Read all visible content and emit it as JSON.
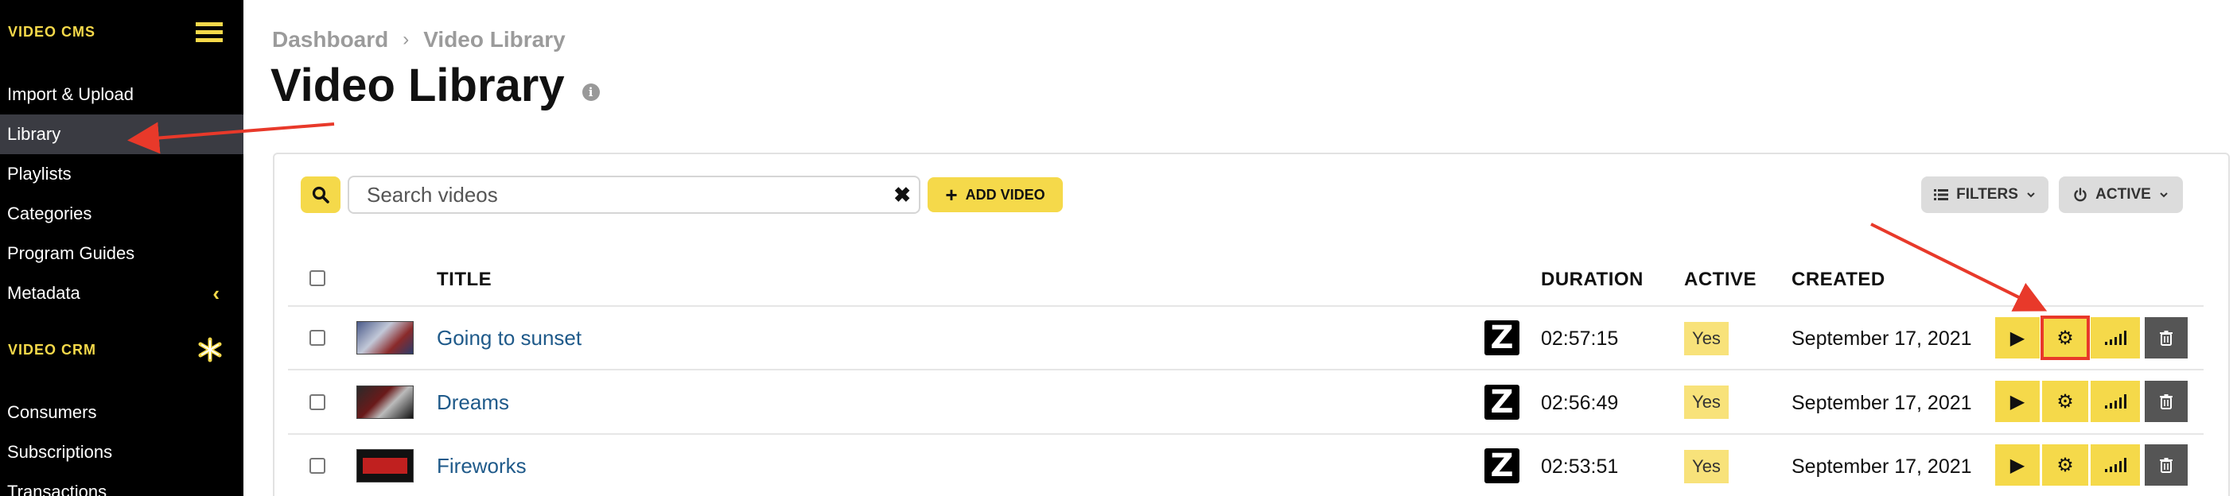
{
  "sidebar": {
    "sections": [
      {
        "title": "VIDEO CMS"
      },
      {
        "title": "VIDEO CRM"
      }
    ],
    "cms_items": [
      {
        "label": "Import & Upload"
      },
      {
        "label": "Library"
      },
      {
        "label": "Playlists"
      },
      {
        "label": "Categories"
      },
      {
        "label": "Program Guides"
      },
      {
        "label": "Metadata"
      }
    ],
    "crm_items": [
      {
        "label": "Consumers"
      },
      {
        "label": "Subscriptions"
      },
      {
        "label": "Transactions"
      }
    ],
    "active_item": "Library",
    "icons": [
      "hamburger-icon",
      "chevron-left-icon",
      "asterisk-icon"
    ]
  },
  "header": {
    "breadcrumb": [
      "Dashboard",
      "Video Library"
    ],
    "breadcrumb_separator": "›",
    "title": "Video Library",
    "info_icon": "i"
  },
  "toolbar": {
    "search_placeholder": "Search videos",
    "search_value": "",
    "clear_icon": "✖",
    "add_label": "ADD VIDEO",
    "add_icon": "+",
    "filters_label": "FILTERS",
    "active_label": "ACTIVE"
  },
  "table": {
    "columns": {
      "title": "TITLE",
      "duration": "DURATION",
      "active": "ACTIVE",
      "created": "CREATED"
    },
    "rows": [
      {
        "title": "Going to sunset",
        "channel_logo": "Z",
        "duration": "02:57:15",
        "active": "Yes",
        "created": "September 17, 2021"
      },
      {
        "title": "Dreams",
        "channel_logo": "Z",
        "duration": "02:56:49",
        "active": "Yes",
        "created": "September 17, 2021"
      },
      {
        "title": "Fireworks",
        "channel_logo": "Z",
        "duration": "02:53:51",
        "active": "Yes",
        "created": "September 17, 2021"
      }
    ],
    "row_actions": [
      "play-icon",
      "gear-icon",
      "signal-bars-icon",
      "trash-icon"
    ]
  },
  "colors": {
    "accent": "#f5d94a",
    "sidebar_bg": "#000000",
    "sidebar_active": "#3a3b42",
    "link": "#1f5a8a",
    "annotation": "#e8392a"
  }
}
